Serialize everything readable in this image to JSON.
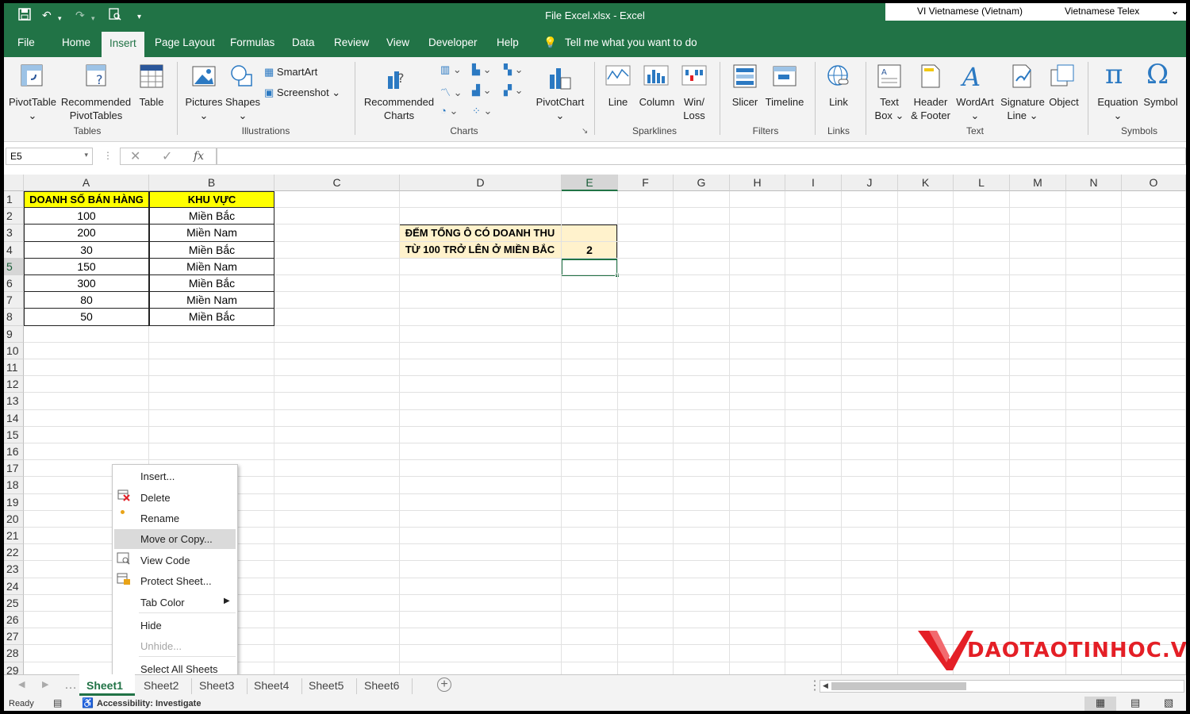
{
  "window": {
    "title": "File Excel.xlsx  -  Excel"
  },
  "ime": {
    "language": "VI  Vietnamese (Vietnam)",
    "keyboard": "Vietnamese Telex"
  },
  "tabs": [
    "File",
    "Home",
    "Insert",
    "Page Layout",
    "Formulas",
    "Data",
    "Review",
    "View",
    "Developer",
    "Help"
  ],
  "active_tab": "Insert",
  "tell_me": "Tell me what you want to do",
  "ribbon": {
    "pivottable": "PivotTable",
    "recommended_pivot_1": "Recommended",
    "recommended_pivot_2": "PivotTables",
    "table": "Table",
    "group_tables": "Tables",
    "pictures": "Pictures",
    "shapes": "Shapes",
    "smartart": "SmartArt",
    "screenshot": "Screenshot",
    "group_illustrations": "Illustrations",
    "recommended_charts_1": "Recommended",
    "recommended_charts_2": "Charts",
    "pivotchart": "PivotChart",
    "group_charts": "Charts",
    "line": "Line",
    "column": "Column",
    "winloss_1": "Win/",
    "winloss_2": "Loss",
    "group_sparklines": "Sparklines",
    "slicer": "Slicer",
    "timeline": "Timeline",
    "group_filters": "Filters",
    "link": "Link",
    "group_links": "Links",
    "textbox_1": "Text",
    "textbox_2": "Box",
    "header_1": "Header",
    "header_2": "& Footer",
    "wordart": "WordArt",
    "signature_1": "Signature",
    "signature_2": "Line",
    "object": "Object",
    "group_text": "Text",
    "equation": "Equation",
    "symbol": "Symbol",
    "group_symbols": "Symbols"
  },
  "formula_bar": {
    "name_box": "E5",
    "fx": "fx",
    "value": ""
  },
  "columns": [
    "A",
    "B",
    "C",
    "D",
    "E",
    "F",
    "G",
    "H",
    "I",
    "J",
    "K",
    "L",
    "M",
    "N",
    "O"
  ],
  "rows": [
    "1",
    "2",
    "3",
    "4",
    "5",
    "6",
    "7",
    "8",
    "9",
    "10",
    "11",
    "12",
    "13",
    "14",
    "15",
    "16",
    "17",
    "18",
    "19",
    "20",
    "21",
    "22",
    "23",
    "24",
    "25",
    "26",
    "27",
    "28",
    "29"
  ],
  "table": {
    "headers": [
      "DOANH SỐ BÁN HÀNG",
      "KHU VỰC"
    ],
    "rows": [
      [
        "100",
        "Miền Bắc"
      ],
      [
        "200",
        "Miền Nam"
      ],
      [
        "30",
        "Miền Bắc"
      ],
      [
        "150",
        "Miền Nam"
      ],
      [
        "300",
        "Miền Bắc"
      ],
      [
        "80",
        "Miền Nam"
      ],
      [
        "50",
        "Miền Bắc"
      ]
    ]
  },
  "result": {
    "label_line1": "ĐẾM TỔNG Ô CÓ DOANH THU",
    "label_line2": "TỪ 100 TRỞ LÊN Ở MIỀN BẮC",
    "value": "2"
  },
  "context_menu": [
    "Insert...",
    "Delete",
    "Rename",
    "Move or Copy...",
    "View Code",
    "Protect Sheet...",
    "Tab Color",
    "Hide",
    "Unhide...",
    "Select All Sheets"
  ],
  "sheets": [
    "Sheet1",
    "Sheet2",
    "Sheet3",
    "Sheet4",
    "Sheet5",
    "Sheet6"
  ],
  "status": {
    "ready": "Ready",
    "accessibility": "Accessibility: Investigate"
  },
  "watermark": "DAOTAOTINHOC.VN",
  "colors": {
    "excel_green": "#217346",
    "header_fill": "#ffff00",
    "result_fill": "#fff2cc",
    "brand_red": "#e41f26"
  }
}
